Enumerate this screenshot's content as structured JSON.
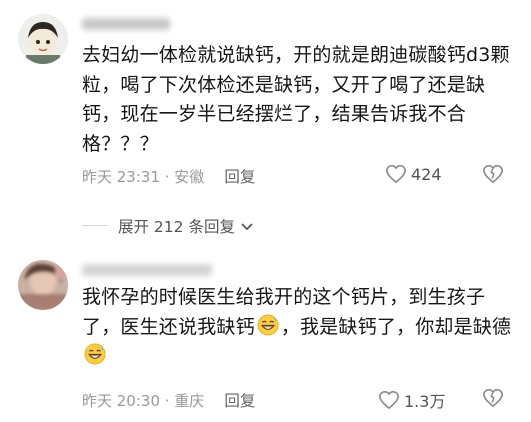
{
  "comments": [
    {
      "username": "",
      "text": "去妇幼一体检就说缺钙，开的就是朗迪碳酸钙d3颗粒，喝了下次体检还是缺钙，又开了喝了还是缺钙，现在一岁半已经摆烂了，结果告诉我不合格？？？",
      "time_location": "昨天 23:31 · 安徽",
      "reply_label": "回复",
      "likes": "424"
    },
    {
      "username": "",
      "text_parts": [
        "我怀孕的时候医生给我开的这个钙片，到生孩子了，医生还说我缺钙",
        "，我是缺钙了，你却是缺德"
      ],
      "time_location": "昨天 20:30 · 重庆",
      "reply_label": "回复",
      "likes": "1.3万"
    }
  ],
  "expand": {
    "label": "展开 212 条回复"
  },
  "colors": {
    "text": "#161616",
    "meta": "#9a9a9a",
    "icon": "#8a8a8a"
  },
  "icons": {
    "like": "heart-outline-icon",
    "dislike": "broken-heart-icon",
    "expand": "chevron-down-icon",
    "emoji": "grinning-sweat-emoji-icon"
  }
}
